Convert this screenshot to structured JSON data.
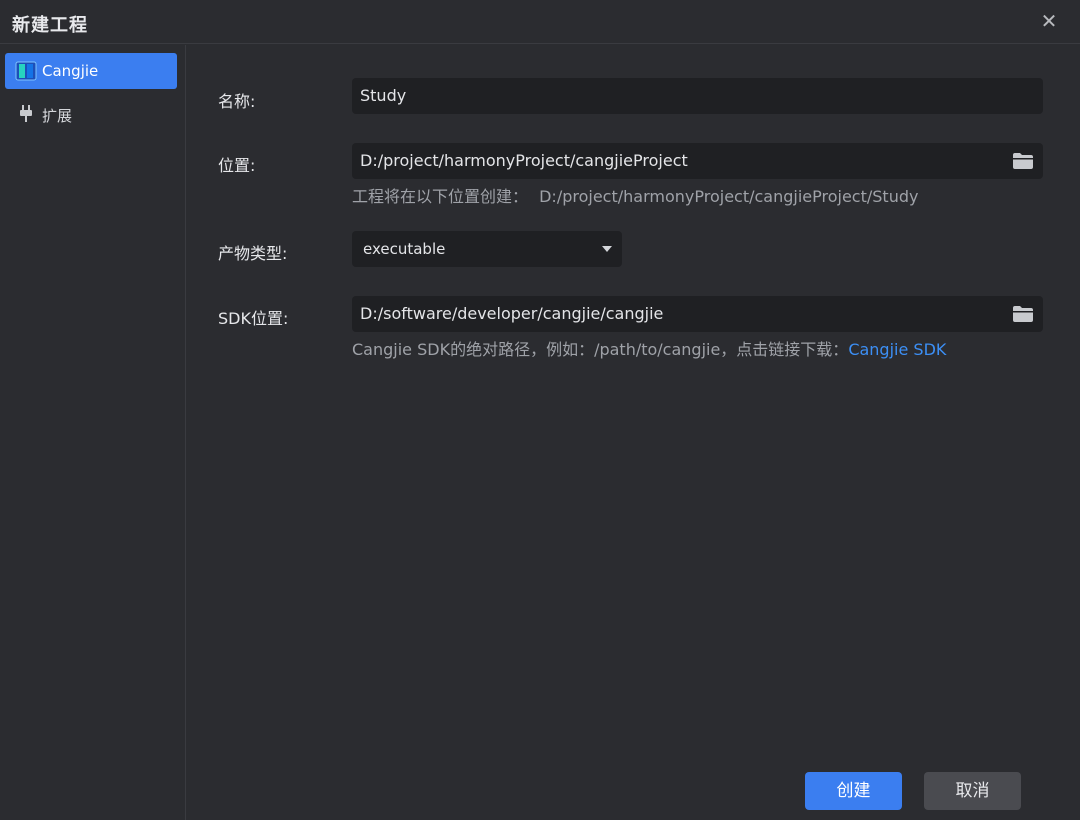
{
  "window": {
    "title": "新建工程",
    "close_icon": "close-icon"
  },
  "sidebar": {
    "items": [
      {
        "label": "Cangjie",
        "icon": "cangjie-logo-icon",
        "active": true
      },
      {
        "label": "扩展",
        "icon": "plug-icon",
        "active": false
      }
    ]
  },
  "form": {
    "name": {
      "label": "名称:",
      "value": "Study"
    },
    "location": {
      "label": "位置:",
      "value": "D:/project/harmonyProject/cangjieProject",
      "hint_prefix": "工程将在以下位置创建：",
      "hint_path": "D:/project/harmonyProject/cangjieProject/Study"
    },
    "artifact_type": {
      "label": "产物类型:",
      "value": "executable"
    },
    "sdk": {
      "label": "SDK位置:",
      "value": "D:/software/developer/cangjie/cangjie",
      "hint_text": "Cangjie SDK的绝对路径，例如：/path/to/cangjie，点击链接下载：",
      "hint_link": "Cangjie SDK"
    }
  },
  "buttons": {
    "create": "创建",
    "cancel": "取消"
  },
  "colors": {
    "accent": "#3b7ef0",
    "link": "#3c8ff5",
    "background": "#2b2c30",
    "input": "#1f2023"
  }
}
